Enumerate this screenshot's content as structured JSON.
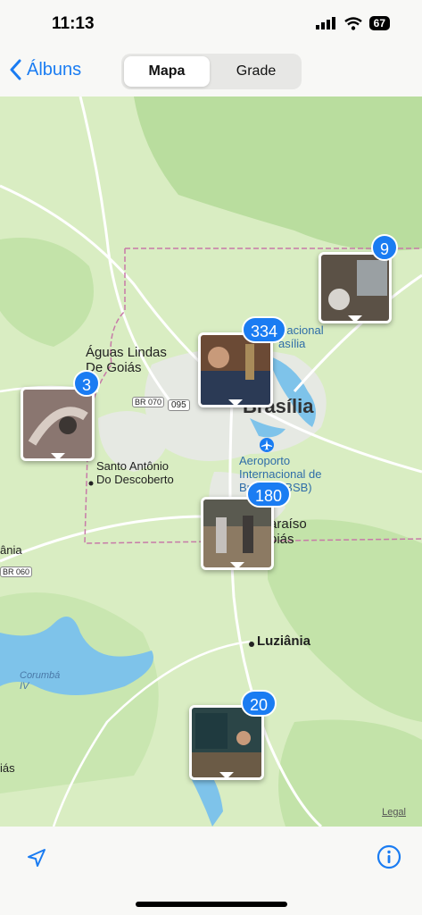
{
  "status": {
    "time": "11:13",
    "battery": "67"
  },
  "nav": {
    "back_label": "Álbuns",
    "segments": [
      "Mapa",
      "Grade"
    ],
    "selected": "Mapa"
  },
  "map": {
    "labels": {
      "aguas_lindas_1": "Águas Lindas",
      "aguas_lindas_2": "De Goiás",
      "santo_antonio_1": "Santo Antônio",
      "santo_antonio_2": "Do Descoberto",
      "brasilia": "Brasília",
      "parque_1": "Nacional",
      "parque_2": "asília",
      "aeroporto_1": "Aeroporto",
      "aeroporto_2": "Internacional de",
      "aeroporto_3": "Brasília (BSB)",
      "paraiso_1": "araíso",
      "paraiso_2": "oiás",
      "luziania": "Luziânia",
      "left_1": "ânia",
      "left_2": "iás",
      "corumba_1": "Corumbá",
      "corumba_2": "IV",
      "road_br070": "BR 070",
      "road_095": "095",
      "road_left": "BR 060"
    },
    "clusters": [
      {
        "count": "9",
        "photo_color": "#5b5146"
      },
      {
        "count": "334",
        "photo_color": "#6b4a35"
      },
      {
        "count": "3",
        "photo_color": "#8a7670"
      },
      {
        "count": "180",
        "photo_color": "#8c7a63"
      },
      {
        "count": "20",
        "photo_color": "#2b4547"
      }
    ],
    "legal": "Legal"
  },
  "colors": {
    "accent": "#1a7cf2",
    "map_base": "#d9edc2",
    "water": "#7ec3ea"
  }
}
